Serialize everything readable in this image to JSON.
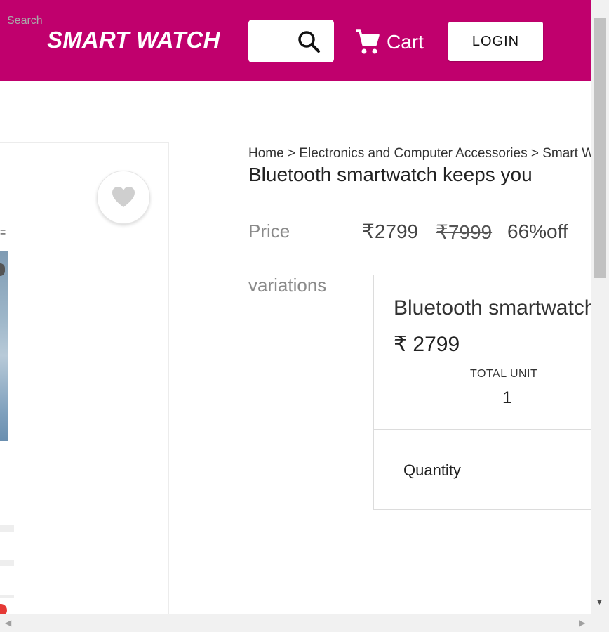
{
  "header": {
    "logo": "SMART WATCH",
    "search": {
      "placeholder": "Search",
      "value": ""
    },
    "cart_label": "Cart",
    "login_label": "LOGIN"
  },
  "breadcrumb": "Home > Electronics and Computer Accessories > Smart Watches",
  "product": {
    "title": "Bluetooth smartwatch keeps you",
    "price_label": "Price",
    "price_current": "₹2799",
    "price_original": "₹7999",
    "discount": "66%off",
    "variations_label": "variations"
  },
  "variation": {
    "name": "Bluetooth smartwatch",
    "price": "₹ 2799",
    "total_unit_label": "TOTAL UNIT",
    "total_unit_value": "1",
    "quantity_label": "Quantity"
  },
  "gallery": {
    "menu_glyph": "≡"
  },
  "colors": {
    "header_bg": "#c0006d"
  },
  "icons": {
    "search": "search-icon",
    "cart": "cart-icon",
    "wishlist": "heart-icon"
  }
}
